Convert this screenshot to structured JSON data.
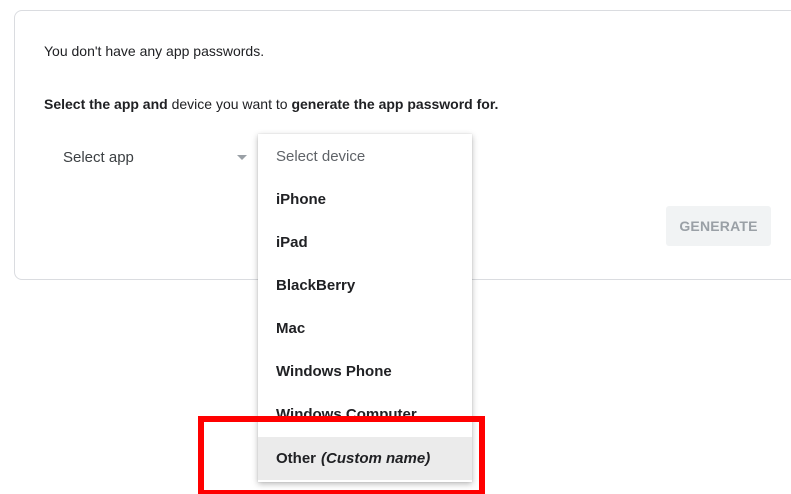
{
  "app_passwords": {
    "empty_message": "You don't have any app passwords.",
    "instructions_bold_1": "Select the app and",
    "instructions_normal": "device you want to",
    "instructions_bold_2": "generate the app password for."
  },
  "select_app": {
    "label": "Select app"
  },
  "device_menu": {
    "placeholder": "Select device",
    "items": [
      "iPhone",
      "iPad",
      "BlackBerry",
      "Mac",
      "Windows Phone",
      "Windows Computer"
    ],
    "other_label": "Other",
    "other_custom": "(Custom name)"
  },
  "generate_button": {
    "label": "GENERATE"
  },
  "highlight_color": "#ff0000"
}
